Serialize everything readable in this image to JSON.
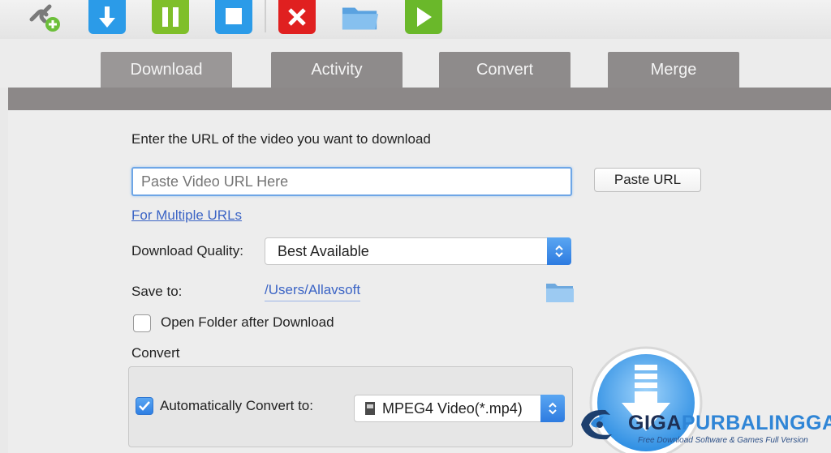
{
  "toolbar": {
    "icons": [
      "link-add-icon",
      "download-icon",
      "pause-icon",
      "stop-icon",
      "cancel-icon",
      "folder-icon",
      "play-icon"
    ],
    "colors": {
      "download": "#2b9be8",
      "pause": "#7fbf2a",
      "stop": "#2b9be8",
      "cancel": "#e02020",
      "play": "#6ab82a",
      "folder": "#6fb0e8"
    }
  },
  "tabs": [
    {
      "label": "Download"
    },
    {
      "label": "Activity"
    },
    {
      "label": "Convert"
    },
    {
      "label": "Merge"
    }
  ],
  "form": {
    "url_prompt": "Enter the URL of the video you want to download",
    "url_placeholder": "Paste Video URL Here",
    "paste_button": "Paste URL",
    "multiple_urls_link": "For Multiple URLs",
    "quality_label": "Download Quality:",
    "quality_value": "Best Available",
    "save_label": "Save to:",
    "save_path": "/Users/Allavsoft",
    "open_folder_label": "Open Folder after Download",
    "open_folder_checked": false,
    "convert_section_label": "Convert",
    "auto_convert_label": "Automatically Convert to:",
    "auto_convert_checked": true,
    "convert_format": "MPEG4 Video(*.mp4)"
  },
  "watermark": {
    "brand_part1": "GIGA",
    "brand_part2": "PURBALINGGA",
    "tagline": "Free Download Software & Games Full Version"
  }
}
